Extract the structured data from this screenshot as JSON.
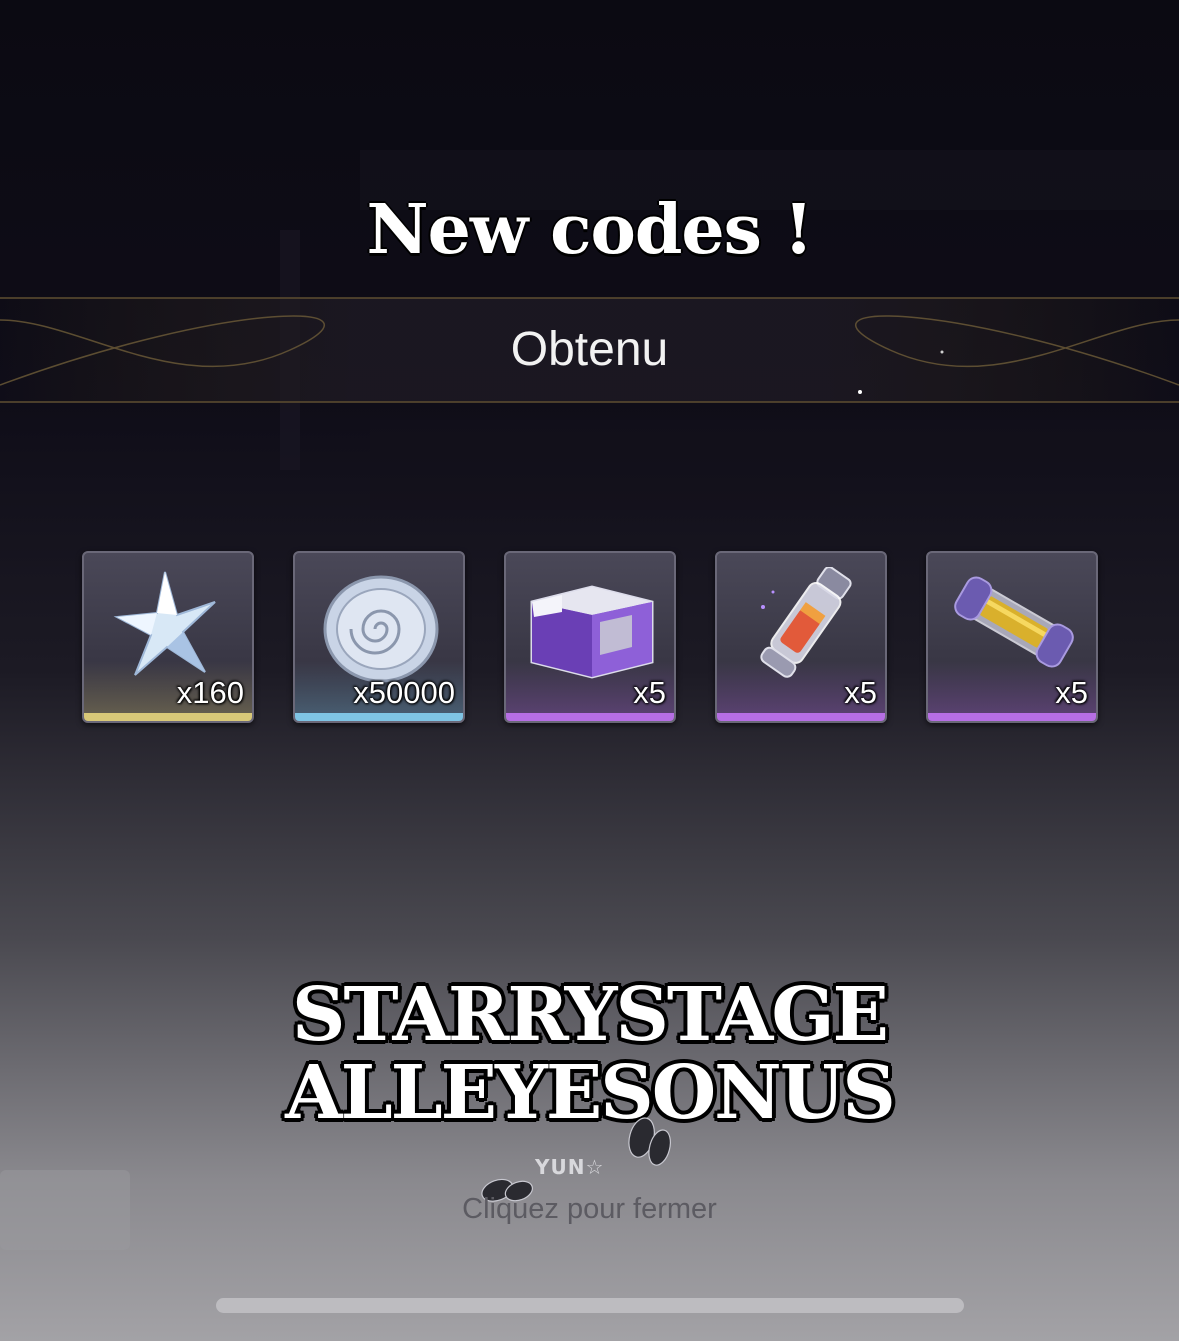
{
  "overlay": {
    "title": "New codes !",
    "codes": [
      "STARRYSTAGE",
      "ALLEYESONUS"
    ],
    "watermark": "YUN☆"
  },
  "dialog": {
    "header": "Obtenu",
    "close_hint": "Cliquez pour fermer"
  },
  "rewards": [
    {
      "icon": "star-crystal-icon",
      "quantity": "x160",
      "rarity_color": "#d8c878"
    },
    {
      "icon": "silver-coin-icon",
      "quantity": "x50000",
      "rarity_color": "#7fc4e4"
    },
    {
      "icon": "supply-crate-icon",
      "quantity": "x5",
      "rarity_color": "#b66ee4"
    },
    {
      "icon": "potion-vial-icon",
      "quantity": "x5",
      "rarity_color": "#b66ee4"
    },
    {
      "icon": "energy-capsule-icon",
      "quantity": "x5",
      "rarity_color": "#b66ee4"
    }
  ]
}
